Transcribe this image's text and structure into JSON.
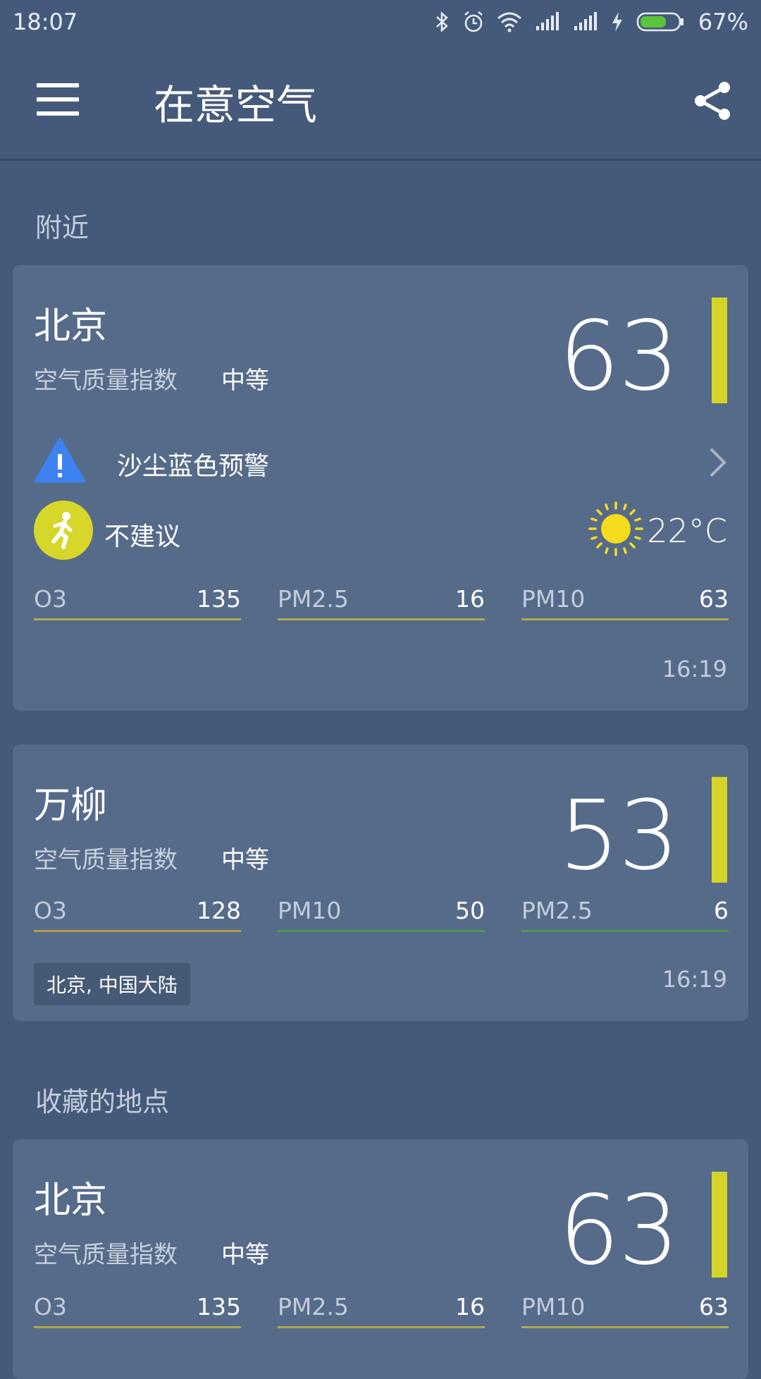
{
  "status_bar": {
    "time": "18:07",
    "battery_percent": "67%",
    "icons": [
      "bluetooth-icon",
      "alarm-icon",
      "wifi-icon",
      "signal-icon",
      "signal-icon",
      "charging-icon",
      "battery-icon"
    ]
  },
  "appbar": {
    "title": "在意空气",
    "menu_icon": "menu-icon",
    "share_icon": "share-icon"
  },
  "sections": {
    "nearby": "附近",
    "favorites": "收藏的地点"
  },
  "cards": [
    {
      "city": "北京",
      "aqi_label": "空气质量指数",
      "aqi_level": "中等",
      "aqi": "63",
      "aqi_color": "#d4d327",
      "alert": "沙尘蓝色预警",
      "activity": "不建议",
      "temperature": "22°C",
      "pollutants": [
        {
          "name": "O3",
          "value": "135"
        },
        {
          "name": "PM2.5",
          "value": "16"
        },
        {
          "name": "PM10",
          "value": "63"
        }
      ],
      "time": "16:19"
    },
    {
      "city": "万柳",
      "aqi_label": "空气质量指数",
      "aqi_level": "中等",
      "aqi": "53",
      "aqi_color": "#d4d327",
      "pollutants": [
        {
          "name": "O3",
          "value": "128"
        },
        {
          "name": "PM10",
          "value": "50"
        },
        {
          "name": "PM2.5",
          "value": "6"
        }
      ],
      "location_chip": "北京, 中国大陆",
      "time": "16:19"
    },
    {
      "city": "北京",
      "aqi_label": "空气质量指数",
      "aqi_level": "中等",
      "aqi": "63",
      "aqi_color": "#d4d327",
      "pollutants": [
        {
          "name": "O3",
          "value": "135"
        },
        {
          "name": "PM2.5",
          "value": "16"
        },
        {
          "name": "PM10",
          "value": "63"
        }
      ]
    }
  ]
}
